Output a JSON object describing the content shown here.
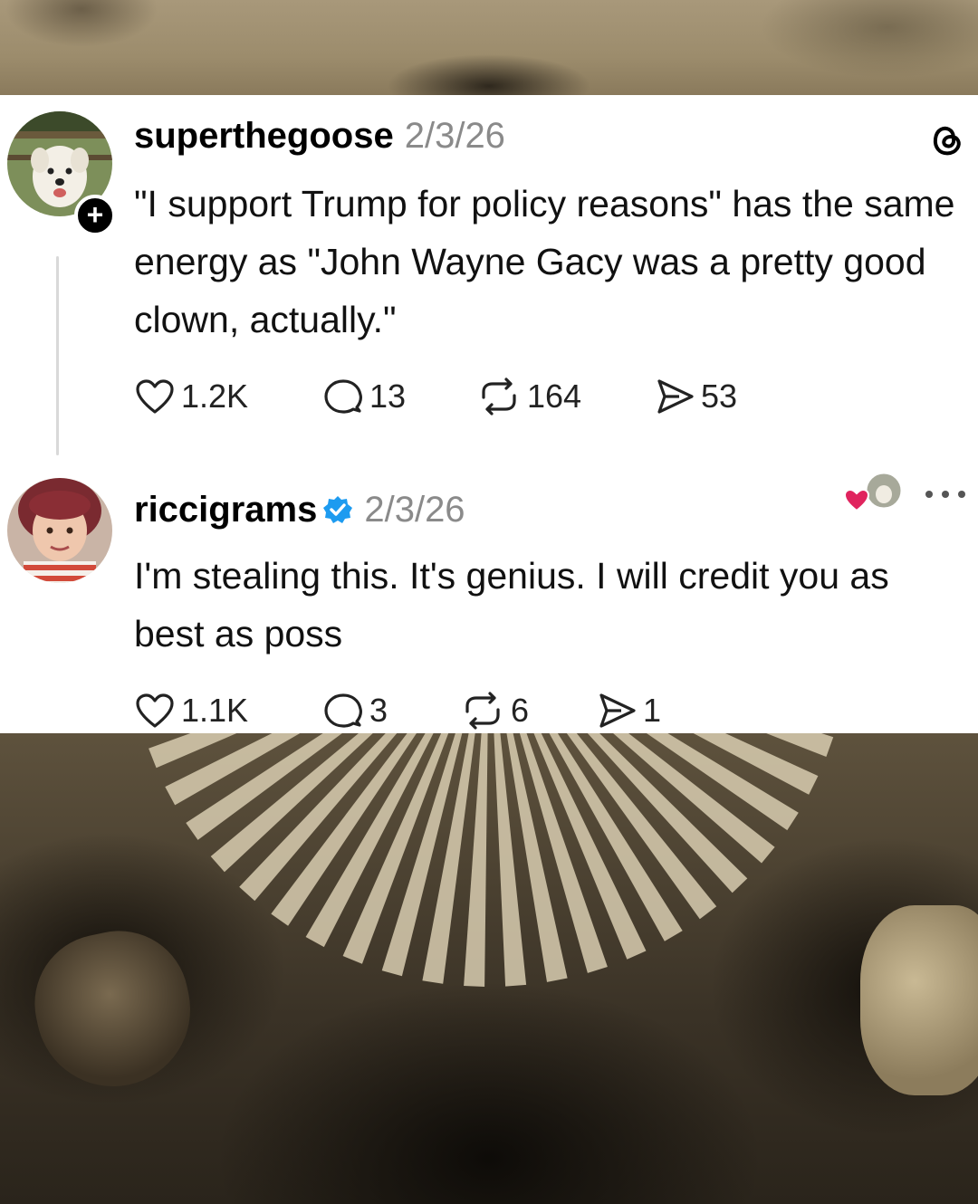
{
  "app": {
    "name": "Threads",
    "logo_icon": "threads-logo-icon"
  },
  "posts": [
    {
      "username": "superthegoose",
      "date": "2/3/26",
      "text": "\"I support Trump for policy reasons\" has the same energy as \"John Wayne Gacy was a pretty good clown, actually.\"",
      "likes": "1.2K",
      "replies": "13",
      "reposts": "164",
      "shares": "53",
      "avatar_icon": "dog-avatar",
      "follow_badge": "+"
    },
    {
      "username": "riccigrams",
      "verified": true,
      "date": "2/3/26",
      "text": "I'm stealing this. It's genius. I will credit you as best as poss",
      "likes": "1.1K",
      "replies": "3",
      "reposts": "6",
      "shares": "1",
      "avatar_icon": "child-avatar",
      "liked_by_author_icon": "heart-icon"
    }
  ],
  "colors": {
    "card_bg": "#ffffff",
    "muted": "#8a8a8a",
    "verified": "#1d9bf0",
    "heart": "#e0245e"
  }
}
